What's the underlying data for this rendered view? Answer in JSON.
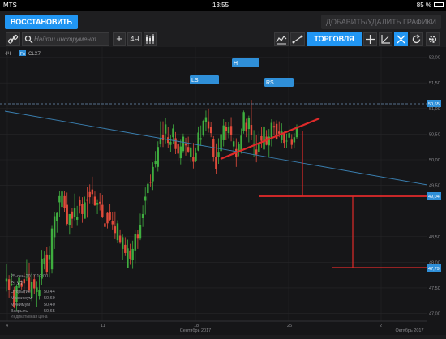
{
  "status": {
    "carrier": "MTS",
    "time": "13:55",
    "battery": "85 %"
  },
  "topbar": {
    "restore_label": "ВОССТАНОВИТЬ",
    "addremove_label": "ДОБАВИТЬ/УДАЛИТЬ ГРАФИКИ"
  },
  "toolbar": {
    "search_placeholder": "Найти инструмент",
    "timeframe": "4Ч",
    "trade_label": "ТОРГОВЛЯ"
  },
  "chart": {
    "timeframe_label": "4Ч",
    "symbol_badge": "Fu",
    "symbol": "CLX7",
    "current_price_label": "50,65",
    "price_labels": {
      "p1": "49,04",
      "p2": "47,79"
    },
    "pattern_labels": {
      "ls": "LS",
      "h": "H",
      "rs": "RS"
    },
    "y_ticks": [
      {
        "v": 52.0,
        "t": "52,00"
      },
      {
        "v": 51.5,
        "t": "51,50"
      },
      {
        "v": 51.0,
        "t": "51,00"
      },
      {
        "v": 50.5,
        "t": "50,50"
      },
      {
        "v": 50.0,
        "t": "50,00"
      },
      {
        "v": 49.5,
        "t": "49,50"
      },
      {
        "v": 48.5,
        "t": "48,50"
      },
      {
        "v": 48.0,
        "t": "48,00"
      },
      {
        "v": 47.5,
        "t": "47,50"
      },
      {
        "v": 47.0,
        "t": "47,00"
      }
    ],
    "x_ticks": [
      {
        "x": 9,
        "t": "4"
      },
      {
        "x": 126,
        "t": "11"
      },
      {
        "x": 241,
        "t": "18"
      },
      {
        "x": 356,
        "t": "25"
      },
      {
        "x": 470,
        "t": "2"
      }
    ],
    "month_labels": [
      {
        "x": 241,
        "t": "Сентябрь 2017"
      },
      {
        "x": 505,
        "t": "Октябрь 2017"
      }
    ],
    "info": {
      "date": "25-сен-2017 12:00",
      "symbol": "CLX7",
      "rows": [
        {
          "k": "Открытие",
          "v": "50,44"
        },
        {
          "k": "Максимум",
          "v": "50,69"
        },
        {
          "k": "Минимум",
          "v": "50,40"
        },
        {
          "k": "Закрыть",
          "v": "50,65"
        }
      ],
      "footer": "Индикативная цена"
    }
  },
  "chart_data": {
    "type": "candlestick",
    "symbol": "CLX7",
    "xlabel": "",
    "ylabel": "",
    "ylim": [
      46.85,
      52.2
    ],
    "last_price": 50.65,
    "target_levels": [
      49.04,
      47.79
    ],
    "ohlc": [
      [
        47.62,
        47.97,
        47.43,
        47.68
      ],
      [
        47.67,
        47.75,
        47.31,
        47.46
      ],
      [
        47.56,
        47.78,
        47.53,
        47.58
      ],
      [
        47.47,
        47.52,
        47.1,
        47.12
      ],
      [
        47.23,
        47.57,
        47.06,
        47.53
      ],
      [
        47.5,
        47.74,
        47.32,
        47.7
      ],
      [
        47.59,
        47.65,
        47.47,
        47.52
      ],
      [
        47.67,
        47.79,
        47.38,
        47.59
      ],
      [
        47.7,
        48.06,
        47.63,
        47.71
      ],
      [
        47.7,
        47.99,
        47.42,
        47.45
      ],
      [
        47.3,
        47.79,
        47.24,
        47.61
      ],
      [
        47.67,
        47.75,
        47.38,
        47.49
      ],
      [
        47.42,
        47.62,
        47.12,
        47.51
      ],
      [
        47.34,
        47.75,
        47.27,
        47.46
      ],
      [
        47.68,
        48.24,
        47.55,
        48.07
      ],
      [
        47.96,
        48.21,
        47.86,
        48.08
      ],
      [
        48.15,
        48.3,
        47.76,
        47.81
      ],
      [
        48.06,
        48.32,
        47.7,
        48.14
      ],
      [
        47.86,
        48.71,
        47.78,
        48.66
      ],
      [
        48.49,
        48.98,
        48.26,
        48.9
      ],
      [
        48.8,
        48.98,
        48.58,
        48.96
      ],
      [
        49.17,
        49.39,
        48.89,
        49.29
      ],
      [
        49.08,
        49.42,
        48.76,
        49.38
      ],
      [
        49.29,
        49.39,
        48.98,
        49.05
      ],
      [
        49.12,
        49.36,
        48.71,
        48.75
      ],
      [
        48.73,
        48.94,
        48.54,
        48.94
      ],
      [
        48.99,
        49.06,
        48.67,
        48.85
      ],
      [
        48.89,
        49.34,
        48.82,
        49.05
      ],
      [
        48.83,
        49.1,
        48.71,
        48.89
      ],
      [
        49.21,
        49.28,
        48.95,
        49.1
      ],
      [
        49.13,
        49.27,
        48.77,
        48.94
      ],
      [
        48.85,
        49.28,
        48.85,
        49.17
      ],
      [
        49.23,
        49.47,
        48.87,
        49.2
      ],
      [
        49.37,
        49.52,
        49.15,
        49.27
      ],
      [
        49.42,
        49.67,
        49.14,
        49.33
      ],
      [
        49.28,
        49.38,
        49.1,
        49.11
      ],
      [
        49.12,
        49.23,
        48.94,
        49.16
      ],
      [
        49.18,
        49.35,
        49.01,
        49.15
      ],
      [
        49.12,
        49.31,
        48.86,
        48.89
      ],
      [
        48.76,
        49.02,
        48.61,
        48.69
      ],
      [
        48.96,
        48.98,
        48.66,
        48.76
      ],
      [
        48.98,
        49.13,
        48.81,
        48.83
      ],
      [
        48.81,
        48.98,
        48.64,
        48.74
      ],
      [
        48.7,
        48.99,
        48.45,
        48.57
      ],
      [
        48.43,
        48.82,
        48.37,
        48.76
      ],
      [
        48.52,
        48.64,
        48.36,
        48.38
      ],
      [
        48.26,
        48.54,
        48.05,
        48.49
      ],
      [
        48.34,
        48.49,
        48.12,
        48.18
      ],
      [
        47.89,
        48.44,
        47.89,
        48.27
      ],
      [
        48.23,
        48.36,
        47.95,
        48.07
      ],
      [
        48.04,
        48.42,
        47.87,
        48.26
      ],
      [
        48.23,
        48.64,
        47.98,
        48.56
      ],
      [
        48.54,
        48.63,
        48.26,
        48.46
      ],
      [
        48.46,
        48.95,
        48.43,
        48.73
      ],
      [
        48.86,
        49.11,
        48.69,
        48.94
      ],
      [
        49.2,
        49.46,
        48.93,
        49.28
      ],
      [
        49.35,
        49.58,
        49.12,
        49.53
      ],
      [
        49.57,
        49.71,
        49.48,
        49.55
      ],
      [
        49.58,
        49.95,
        49.41,
        49.86
      ],
      [
        49.92,
        50.17,
        49.85,
        49.98
      ],
      [
        49.86,
        50.36,
        49.77,
        50.25
      ],
      [
        50.3,
        50.75,
        50.25,
        50.41
      ],
      [
        50.48,
        50.75,
        50.25,
        50.38
      ],
      [
        50.51,
        50.82,
        50.32,
        50.69
      ],
      [
        50.44,
        50.64,
        50.23,
        50.33
      ],
      [
        50.29,
        50.49,
        50.15,
        50.35
      ],
      [
        50.44,
        50.69,
        50.3,
        50.61
      ],
      [
        50.42,
        50.54,
        50.11,
        50.21
      ],
      [
        50.3,
        50.39,
        49.99,
        50.12
      ],
      [
        50.03,
        50.39,
        49.91,
        50.26
      ],
      [
        50.17,
        50.51,
        50.13,
        50.45
      ],
      [
        50.32,
        50.43,
        50.08,
        50.28
      ],
      [
        50.25,
        50.45,
        50.13,
        50.16
      ],
      [
        50.06,
        50.26,
        49.95,
        50.24
      ],
      [
        50.06,
        50.33,
        49.83,
        49.96
      ],
      [
        49.97,
        50.24,
        49.95,
        50.13
      ],
      [
        50.18,
        50.65,
        50.17,
        50.53
      ],
      [
        50.39,
        50.67,
        50.27,
        50.42
      ],
      [
        50.49,
        50.78,
        50.45,
        50.76
      ],
      [
        50.74,
        50.96,
        50.57,
        50.83
      ],
      [
        50.75,
        51.0,
        50.53,
        50.61
      ],
      [
        50.64,
        50.74,
        50.44,
        50.52
      ],
      [
        50.4,
        50.46,
        49.96,
        50.05
      ],
      [
        50.06,
        50.32,
        49.73,
        49.82
      ],
      [
        50.05,
        50.42,
        49.92,
        50.14
      ],
      [
        50.17,
        50.57,
        49.98,
        50.5
      ],
      [
        50.38,
        50.79,
        50.26,
        50.67
      ],
      [
        50.64,
        50.74,
        50.38,
        50.57
      ],
      [
        50.52,
        50.74,
        50.42,
        50.64
      ],
      [
        50.66,
        50.83,
        50.36,
        50.49
      ],
      [
        50.26,
        50.43,
        50.12,
        50.36
      ],
      [
        50.21,
        50.42,
        49.86,
        50.06
      ],
      [
        50.15,
        50.35,
        50.07,
        50.3
      ],
      [
        50.19,
        50.61,
        50.12,
        50.47
      ],
      [
        50.57,
        50.96,
        50.51,
        50.93
      ],
      [
        50.72,
        50.8,
        50.44,
        50.55
      ],
      [
        50.6,
        50.86,
        50.34,
        50.81
      ],
      [
        50.68,
        51.17,
        50.38,
        50.49
      ],
      [
        50.31,
        50.58,
        50.06,
        50.32
      ],
      [
        50.2,
        50.49,
        49.95,
        50.1
      ],
      [
        50.15,
        50.55,
        50.04,
        50.33
      ],
      [
        50.46,
        50.64,
        50.24,
        50.37
      ],
      [
        50.2,
        50.74,
        50.15,
        50.65
      ],
      [
        50.45,
        50.58,
        50.28,
        50.29
      ],
      [
        50.28,
        50.6,
        50.06,
        50.45
      ],
      [
        50.42,
        50.79,
        50.26,
        50.72
      ],
      [
        50.66,
        50.75,
        50.48,
        50.63
      ],
      [
        50.7,
        50.77,
        50.39,
        50.41
      ],
      [
        50.55,
        50.75,
        50.44,
        50.51
      ],
      [
        50.38,
        50.71,
        50.33,
        50.55
      ],
      [
        50.51,
        50.55,
        50.23,
        50.33
      ],
      [
        50.36,
        50.51,
        50.23,
        50.37
      ],
      [
        50.43,
        50.67,
        50.39,
        50.52
      ],
      [
        50.39,
        50.5,
        50.21,
        50.29
      ],
      [
        50.34,
        50.52,
        50.22,
        50.44
      ],
      [
        50.44,
        50.69,
        50.4,
        50.65
      ]
    ]
  }
}
